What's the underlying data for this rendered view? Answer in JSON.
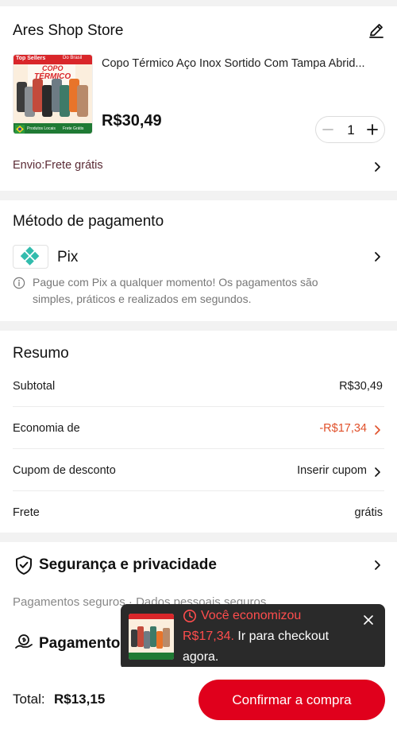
{
  "store": {
    "name": "Ares Shop Store",
    "edit_icon": "pencil-icon",
    "product": {
      "title": "Copo Térmico Aço Inox Sortido Com Tampa Abrid...",
      "price": "R$30,49",
      "quantity": "1",
      "image_text": {
        "badge_left": "Top Sellers",
        "badge_right": "Do Brasil",
        "headline_top": "COPO",
        "headline_bottom": "TÉRMICO",
        "footer_left": "Produtos Locais",
        "footer_right": "Frete Grátis"
      }
    },
    "shipping": "Envio:Frete grátis"
  },
  "payment": {
    "heading": "Método de pagamento",
    "method": "Pix",
    "method_icon": "pix-icon",
    "info": "Pague com Pix a qualquer momento! Os pagamentos são simples, práticos e realizados em segundos.",
    "info_line1": "Pague com Pix a qualquer momento! Os pagamentos são",
    "info_line2": "simples, práticos e realizados em segundos."
  },
  "summary": {
    "heading": "Resumo",
    "rows": [
      {
        "label": "Subtotal",
        "value": "R$30,49"
      },
      {
        "label": "Economia de",
        "value": "-R$17,34"
      },
      {
        "label": "Cupom de desconto",
        "value": "Inserir cupom"
      },
      {
        "label": "Frete",
        "value": "grátis"
      }
    ]
  },
  "security": {
    "heading": "Segurança e privacidade",
    "subtitle": "Pagamentos seguros · Dados pessoais seguros",
    "second_heading": "Pagamentos seguros"
  },
  "toast": {
    "title": "Você economizou",
    "amount": "R$17,34.",
    "message_rest": " Ir para checkout",
    "message_line2": "agora."
  },
  "bottom": {
    "total_label": "Total:",
    "total_value": "R$13,15",
    "confirm_label": "Confirmar a compra"
  },
  "colors": {
    "accent": "#e0001c",
    "savings": "#e0502a",
    "shipping": "#5a2a34",
    "pix": "#32bcad"
  }
}
